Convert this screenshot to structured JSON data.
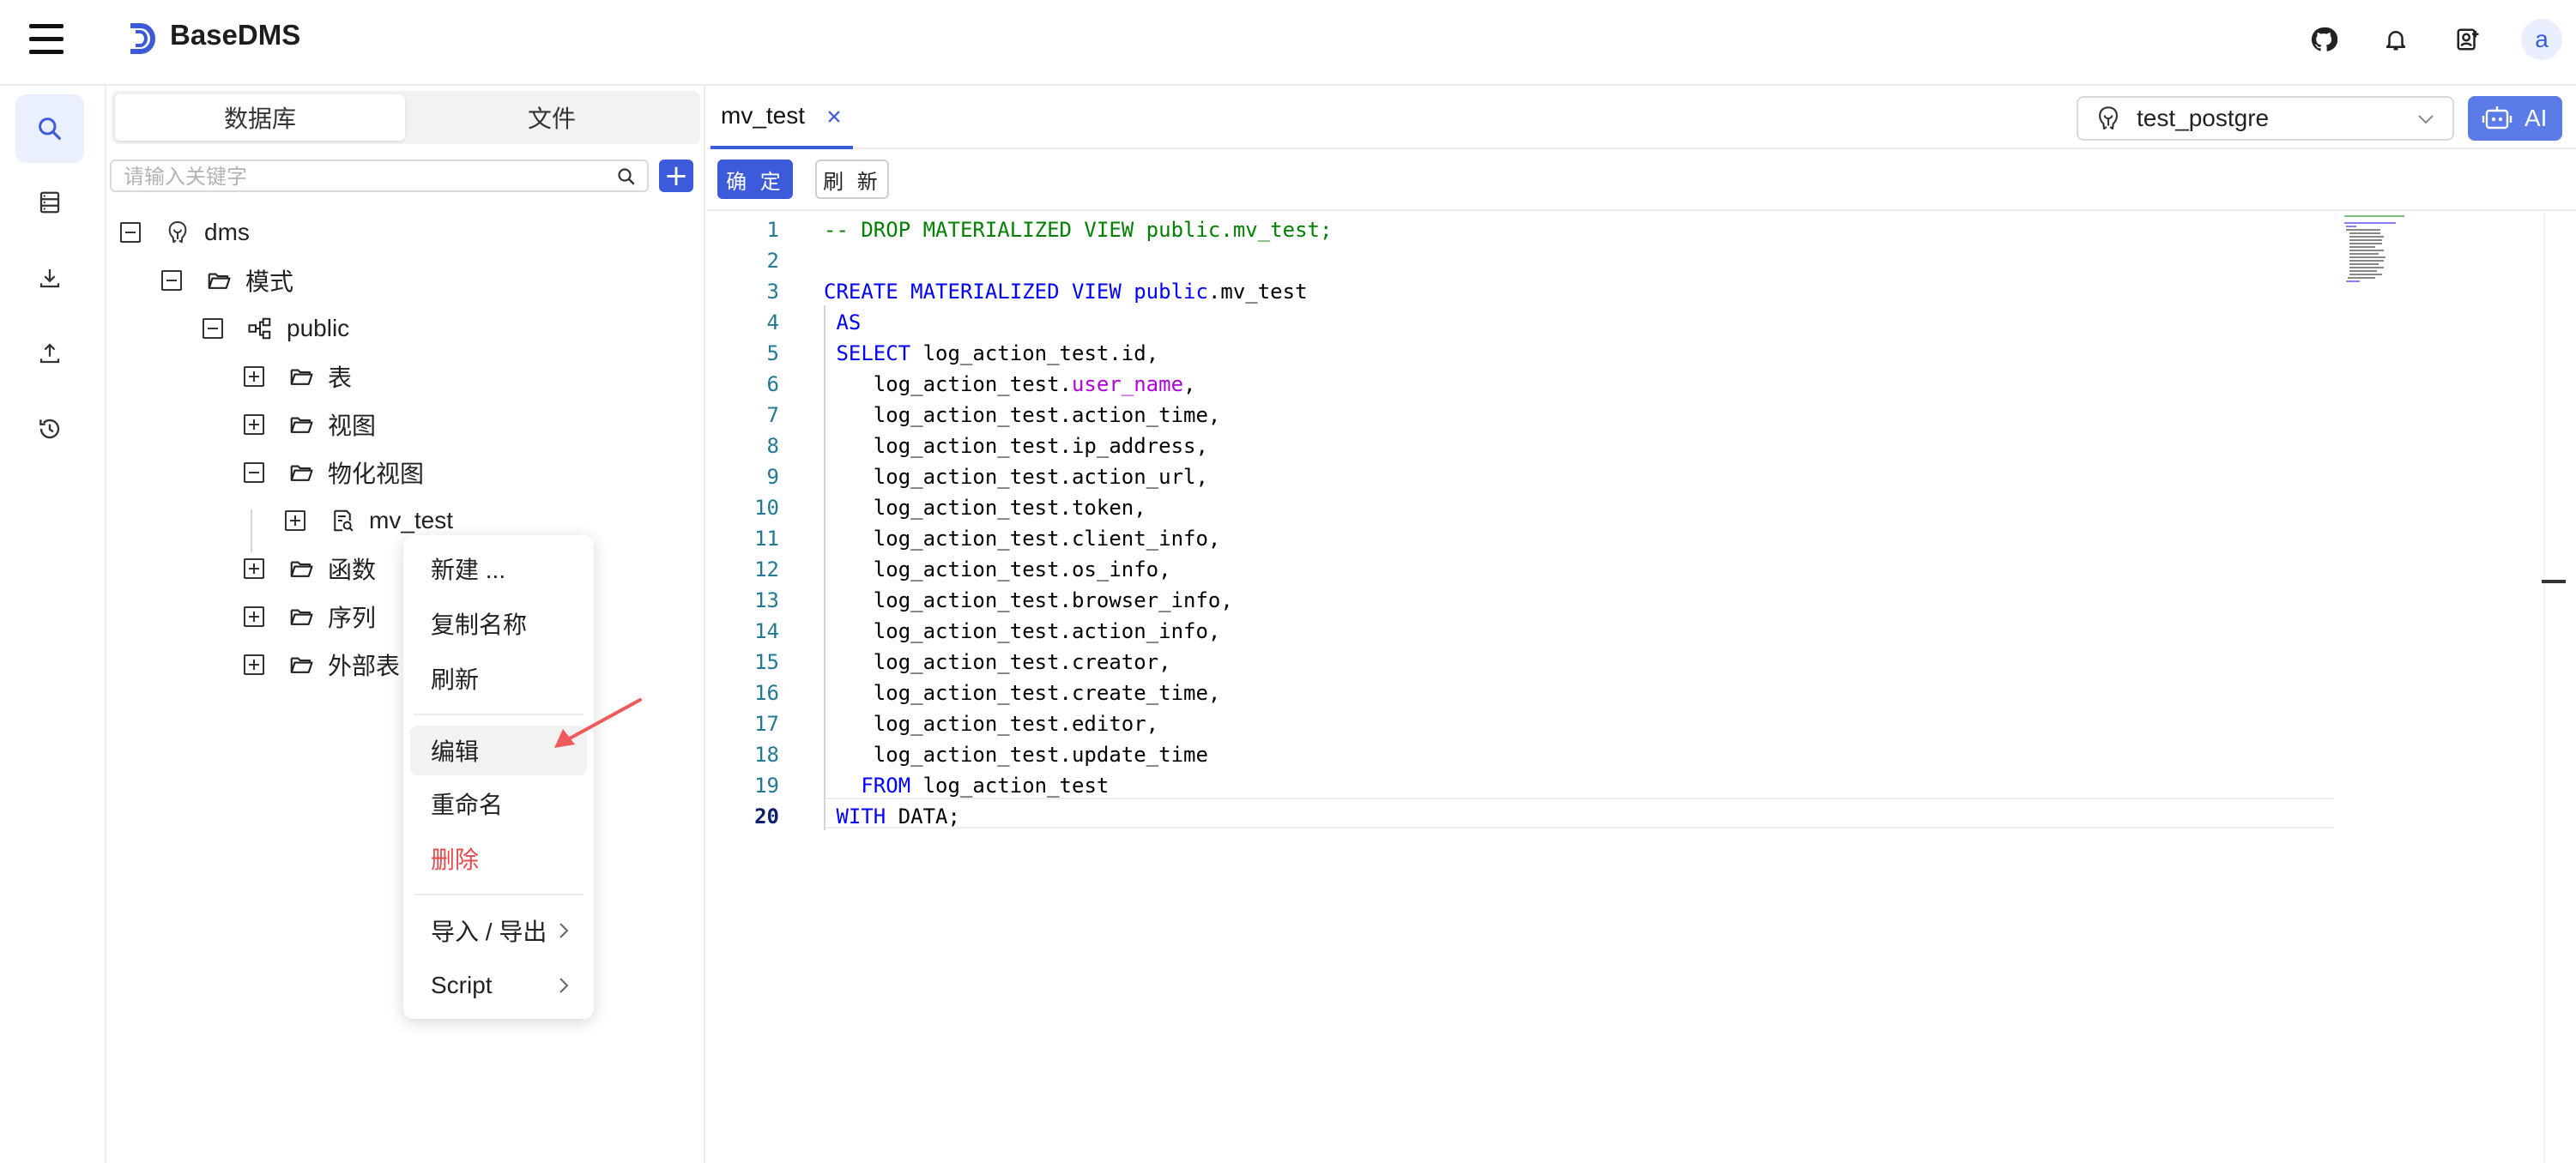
{
  "app": {
    "brand": "BaseDMS",
    "avatar_letter": "a",
    "accent_color": "#3b5bdb"
  },
  "header": {
    "icons": [
      "github-icon",
      "bell-icon",
      "user-add-icon"
    ]
  },
  "rail": {
    "items": [
      "search-icon",
      "database-icon",
      "download-icon",
      "upload-icon",
      "history-icon"
    ],
    "active": "search-icon"
  },
  "sidebar": {
    "segments": [
      "数据库",
      "文件"
    ],
    "active_segment": "数据库",
    "search": {
      "placeholder": "请输入关键字",
      "value": ""
    },
    "add_label": "+",
    "tree": [
      {
        "label": "dms",
        "icon": "postgres-icon",
        "state": "expanded"
      },
      {
        "label": "模式",
        "icon": "folder-open-icon",
        "state": "expanded"
      },
      {
        "label": "public",
        "icon": "schema-icon",
        "state": "expanded"
      },
      {
        "label": "表",
        "icon": "folder-open-icon",
        "state": "collapsed"
      },
      {
        "label": "视图",
        "icon": "folder-open-icon",
        "state": "collapsed"
      },
      {
        "label": "物化视图",
        "icon": "folder-open-icon",
        "state": "expanded"
      },
      {
        "label": "mv_test",
        "icon": "materialized-view-icon",
        "state": "collapsed"
      },
      {
        "label": "函数",
        "icon": "folder-open-icon",
        "state": "collapsed"
      },
      {
        "label": "序列",
        "icon": "folder-open-icon",
        "state": "collapsed"
      },
      {
        "label": "外部表",
        "icon": "folder-open-icon",
        "state": "collapsed"
      }
    ]
  },
  "context_menu": {
    "items": [
      {
        "label": "新建 ..."
      },
      {
        "label": "复制名称"
      },
      {
        "label": "刷新"
      },
      {
        "label": "编辑",
        "highlighted": true
      },
      {
        "label": "重命名"
      },
      {
        "label": "删除",
        "danger": true,
        "color": "#e5484d"
      },
      {
        "label": "导入 / 导出",
        "submenu": true
      },
      {
        "label": "Script",
        "submenu": true
      }
    ]
  },
  "tabs": [
    {
      "label": "mv_test",
      "active": true
    }
  ],
  "db_selector": {
    "value": "test_postgre"
  },
  "ai_button": {
    "label": "AI"
  },
  "toolbar": {
    "confirm_label": "确 定",
    "refresh_label": "刷 新"
  },
  "editor": {
    "current_line": 20,
    "lines": [
      {
        "n": "1",
        "tokens": [
          {
            "t": "-- DROP MATERIALIZED VIEW public.mv_test;",
            "c": "cm"
          }
        ]
      },
      {
        "n": "2",
        "tokens": []
      },
      {
        "n": "3",
        "tokens": [
          {
            "t": "CREATE MATERIALIZED VIEW public",
            "c": "kw"
          },
          {
            "t": ".mv_test",
            "c": ""
          }
        ]
      },
      {
        "n": "4",
        "tokens": [
          {
            "t": " AS",
            "c": "kw"
          }
        ]
      },
      {
        "n": "5",
        "tokens": [
          {
            "t": " SELECT",
            "c": "kw"
          },
          {
            "t": " log_action_test.id,",
            "c": ""
          }
        ]
      },
      {
        "n": "6",
        "tokens": [
          {
            "t": "    log_action_test.",
            "c": ""
          },
          {
            "t": "user_name",
            "c": "fn"
          },
          {
            "t": ",",
            "c": ""
          }
        ]
      },
      {
        "n": "7",
        "tokens": [
          {
            "t": "    log_action_test.action_time,",
            "c": ""
          }
        ]
      },
      {
        "n": "8",
        "tokens": [
          {
            "t": "    log_action_test.ip_address,",
            "c": ""
          }
        ]
      },
      {
        "n": "9",
        "tokens": [
          {
            "t": "    log_action_test.action_url,",
            "c": ""
          }
        ]
      },
      {
        "n": "10",
        "tokens": [
          {
            "t": "    log_action_test.token,",
            "c": ""
          }
        ]
      },
      {
        "n": "11",
        "tokens": [
          {
            "t": "    log_action_test.client_info,",
            "c": ""
          }
        ]
      },
      {
        "n": "12",
        "tokens": [
          {
            "t": "    log_action_test.os_info,",
            "c": ""
          }
        ]
      },
      {
        "n": "13",
        "tokens": [
          {
            "t": "    log_action_test.browser_info,",
            "c": ""
          }
        ]
      },
      {
        "n": "14",
        "tokens": [
          {
            "t": "    log_action_test.action_info,",
            "c": ""
          }
        ]
      },
      {
        "n": "15",
        "tokens": [
          {
            "t": "    log_action_test.creator,",
            "c": ""
          }
        ]
      },
      {
        "n": "16",
        "tokens": [
          {
            "t": "    log_action_test.create_time,",
            "c": ""
          }
        ]
      },
      {
        "n": "17",
        "tokens": [
          {
            "t": "    log_action_test.editor,",
            "c": ""
          }
        ]
      },
      {
        "n": "18",
        "tokens": [
          {
            "t": "    log_action_test.update_time",
            "c": ""
          }
        ]
      },
      {
        "n": "19",
        "tokens": [
          {
            "t": "   FROM",
            "c": "kw"
          },
          {
            "t": " log_action_test",
            "c": ""
          }
        ]
      },
      {
        "n": "20",
        "tokens": [
          {
            "t": " WITH",
            "c": "kw"
          },
          {
            "t": " DATA;",
            "c": ""
          }
        ]
      }
    ]
  }
}
